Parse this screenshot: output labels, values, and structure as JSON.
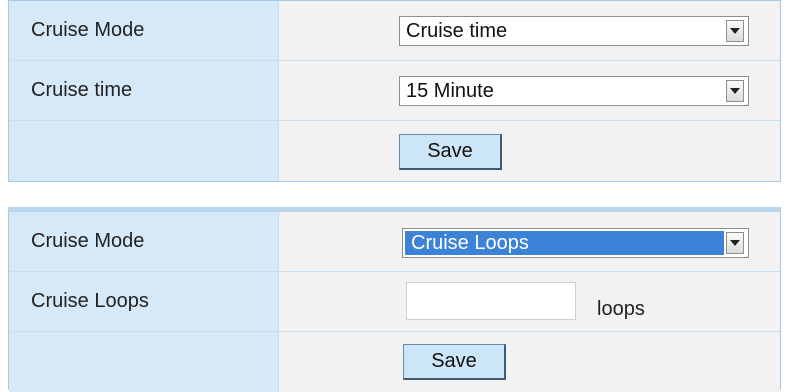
{
  "panel_time": {
    "rows": [
      {
        "label": "Cruise Mode",
        "select_value": "Cruise time"
      },
      {
        "label": "Cruise time",
        "select_value": "15 Minute"
      },
      {
        "label": ""
      }
    ],
    "save_label": "Save"
  },
  "panel_loops": {
    "rows": [
      {
        "label": "Cruise Mode",
        "select_value": "Cruise Loops"
      },
      {
        "label": "Cruise Loops",
        "input_value": "",
        "unit": "loops"
      },
      {
        "label": ""
      }
    ],
    "save_label": "Save"
  },
  "icons": {
    "dropdown": "chevron-down-icon"
  },
  "colors": {
    "label_bg": "#d6e9f8",
    "value_bg": "#f2f2f2",
    "border": "#a9c7e6",
    "button_bg": "#cde6f7",
    "selection": "#3c82d7"
  }
}
